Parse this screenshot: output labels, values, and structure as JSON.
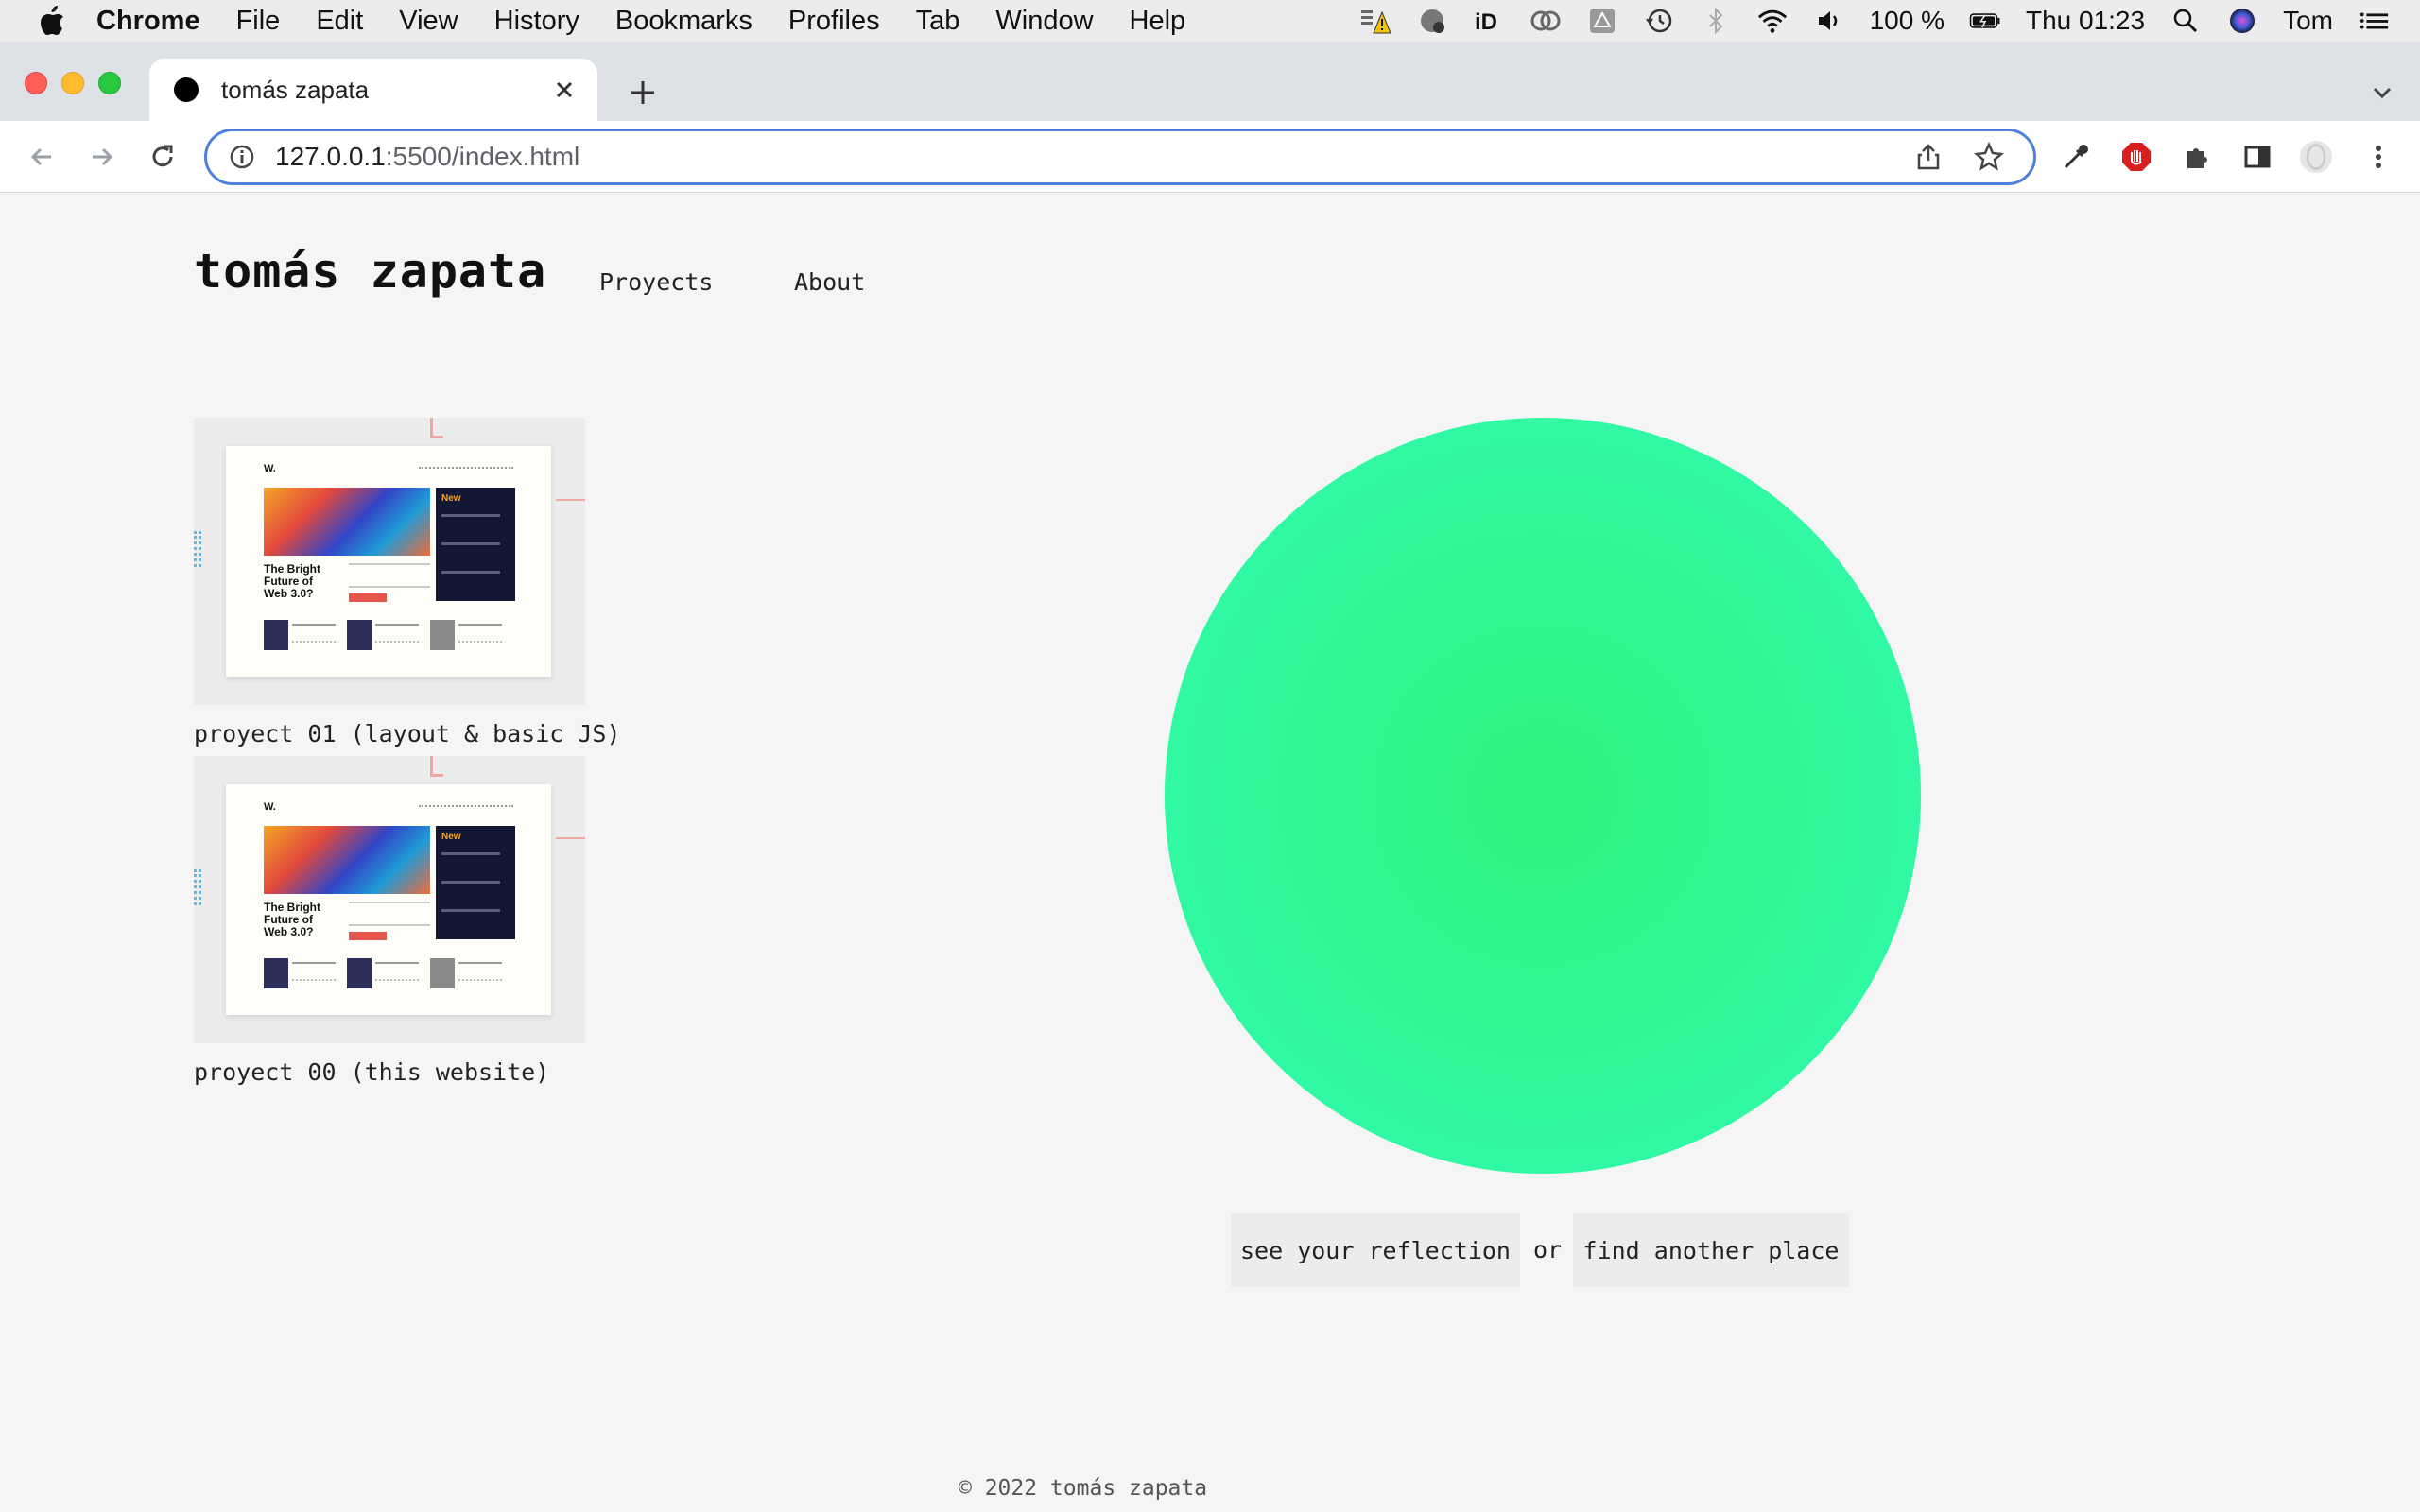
{
  "menubar": {
    "app_name": "Chrome",
    "items": [
      "File",
      "Edit",
      "View",
      "History",
      "Bookmarks",
      "Profiles",
      "Tab",
      "Window",
      "Help"
    ],
    "battery": "100 %",
    "clock": "Thu 01:23",
    "user": "Tom"
  },
  "browser": {
    "tab_title": "tomás zapata",
    "url_host": "127.0.0.1",
    "url_rest": ":5500/index.html"
  },
  "site": {
    "title": "tomás zapata",
    "nav": [
      "Proyects",
      "About"
    ],
    "projects": [
      {
        "caption": "proyect 01 (layout & basic JS)",
        "thumb": {
          "logo": "W.",
          "badge": "New",
          "headline": "The Bright Future of Web 3.0?"
        }
      },
      {
        "caption": "proyect 00 (this website)",
        "thumb": {
          "logo": "W.",
          "badge": "New",
          "headline": "The Bright Future of Web 3.0?"
        }
      }
    ],
    "actions": {
      "reflection": "see your reflection",
      "or": "or",
      "place": "find another place"
    },
    "footer": "© 2022 tomás zapata"
  },
  "colors": {
    "orb": "#33fbb4",
    "orb_center": "#2df47b",
    "omnibox_focus": "#4e82d9"
  }
}
